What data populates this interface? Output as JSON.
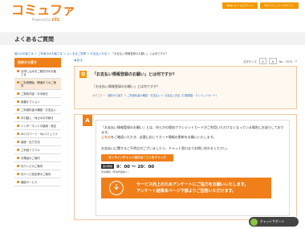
{
  "header": {
    "logo_text": "コミュファ",
    "logo_sub_prefix": "Powered by",
    "logo_sub_brand": "ctc",
    "top_buttons": [
      "Web メールログイン",
      "Myコミュファログイン"
    ]
  },
  "page": {
    "title": "よくあるご質問"
  },
  "breadcrumb": {
    "items": [
      "個人のお客さま",
      "ご利用中のお客さま",
      "よくあるご質問",
      "お支払い方法"
    ],
    "current": "「お支払い情報登録のお願い」とは何ですか？"
  },
  "sidebar": {
    "heading": "目的から探す",
    "items": [
      "お申し込みをご検討中のお客さま",
      "ご利用開始・開通までのご案内",
      "ご契約内容・お手続き",
      "各種オプション",
      "ご利用料金の確認・お支払い",
      "お引越し・休止のお手続き",
      "インターネットの接続・設定",
      "IDパスワード・Myコミュファ",
      "接続・出力方法",
      "ご利用トラブル",
      "光電話のご案内",
      "光テレビのご案内",
      "光テレビ設定等のご案内",
      "通信サービス"
    ]
  },
  "main": {
    "back_label": "◀ 戻る",
    "no_label": "No：3370",
    "font_size_label": "文字サイズ",
    "font_small": "小",
    "font_large": "大",
    "question": {
      "mark": "Q",
      "title": "「お支払い情報登録のお願い」とは何ですか？",
      "body": "「お支払い情報登録のお願い」とは何ですか？",
      "category_label": "カテゴリー：",
      "category_path": "契約から探す ＞ ご利用料金の確認・お支払い ＞ お支払い方法（口座振替・クレジットカード）"
    },
    "answer": {
      "mark": "A",
      "text_line1": "「お支払い情報登録のお願い」とは、何らかの理由でクレジットカードがご利用いただけなくなっている場合にお送りしております。",
      "text_link": "こちら",
      "text_line2": "をご確認いただき、必要に応じてカード情報の更新をお願いいたします。",
      "text_line3": "お支払いに関するご不明点がございましたら、チャット窓口までお問い合わせください。",
      "chat_button_prefix": "オンラインチャット窓口は",
      "chat_button_link": "こちら",
      "chat_button_suffix": "をクリック",
      "hours_label": "受付時間",
      "hours_time": "9：00 ～ 20：00",
      "hours_note": "年中無休（年末年始除く）"
    },
    "banner": {
      "line1": "サービス向上のためアンケートにご協力をお願いいたします。",
      "line2": "アンケート結果本ページ下部よりご回答いただけます。"
    }
  },
  "chat_float": {
    "label": "チャットサポート"
  },
  "colors": {
    "brand_orange": "#f07f1a",
    "link_blue": "#2b6fb6"
  }
}
